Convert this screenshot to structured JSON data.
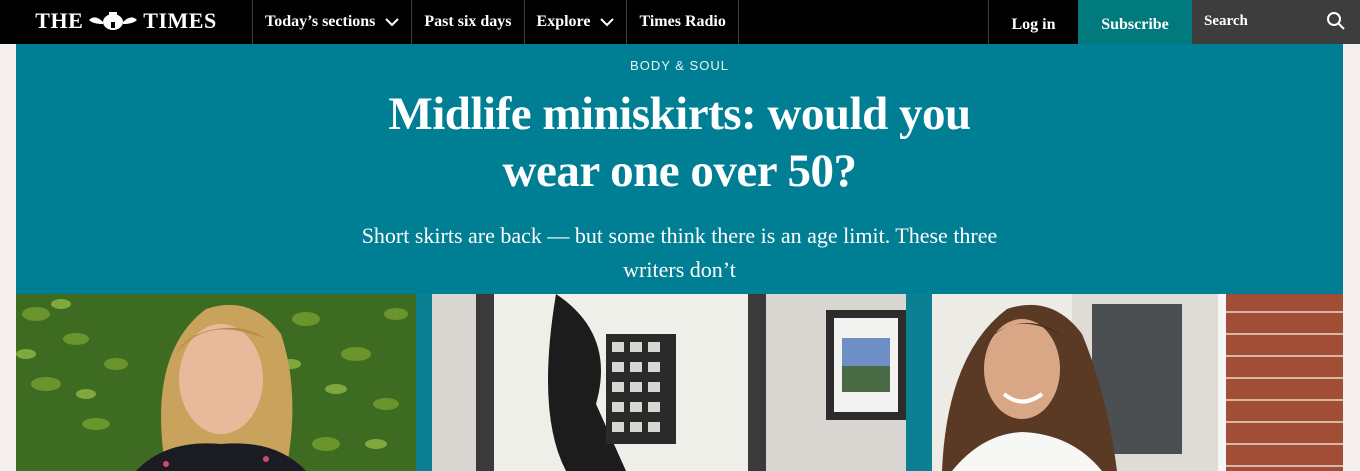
{
  "header": {
    "logo_text_left": "THE",
    "logo_text_right": "TIMES",
    "nav": [
      {
        "label": "Today’s sections",
        "has_dropdown": true
      },
      {
        "label": "Past six days",
        "has_dropdown": false
      },
      {
        "label": "Explore",
        "has_dropdown": true
      },
      {
        "label": "Times Radio",
        "has_dropdown": false
      }
    ],
    "login_label": "Log in",
    "subscribe_label": "Subscribe",
    "search_label": "Search"
  },
  "article": {
    "section": "BODY & SOUL",
    "headline": "Midlife miniskirts: would you wear one over 50?",
    "standfirst": "Short skirts are back — but some think there is an age limit. These three writers don’t"
  },
  "colors": {
    "nav_background": "#000000",
    "subscribe_background": "#007a7d",
    "hero_background": "#007f94",
    "page_background": "#f5f0ed"
  },
  "icons": {
    "crest": "times-crest-icon",
    "dropdown": "chevron-down-icon",
    "search": "search-icon"
  }
}
